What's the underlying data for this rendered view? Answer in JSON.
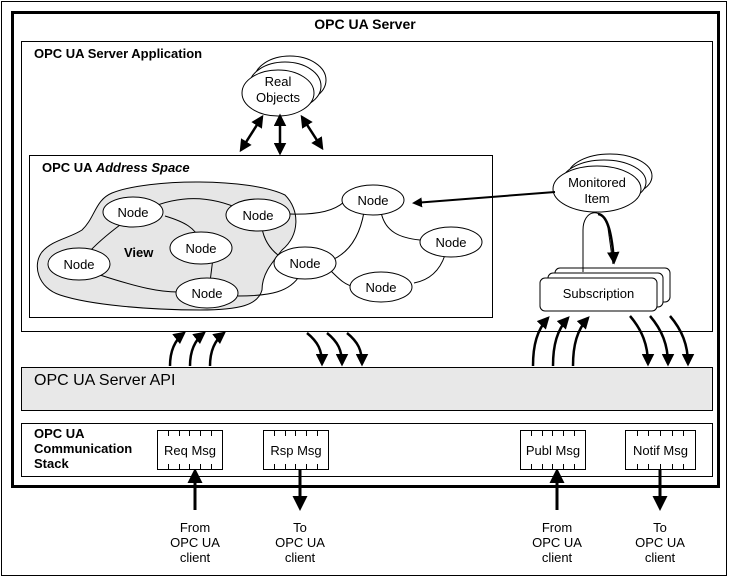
{
  "diagram": {
    "server_title": "OPC UA Server",
    "application_title": "OPC UA Server Application",
    "address_space_title_prefix": "OPC UA ",
    "address_space_title_italic": "Address Space",
    "view_label": "View",
    "real_objects_line1": "Real",
    "real_objects_line2": "Objects",
    "monitored_item_line1": "Monitored",
    "monitored_item_line2": "Item",
    "subscription_label": "Subscription",
    "node_label": "Node",
    "api_title": "OPC UA Server API",
    "stack_title_line1": "OPC UA",
    "stack_title_line2": "Communication",
    "stack_title_line3": "Stack",
    "messages": [
      {
        "label": "Req Msg",
        "direction": "in"
      },
      {
        "label": "Rsp Msg",
        "direction": "out"
      },
      {
        "label": "Publ Msg",
        "direction": "in"
      },
      {
        "label": "Notif Msg",
        "direction": "out"
      }
    ],
    "clients": [
      {
        "line1": "From",
        "line2": "OPC UA",
        "line3": "client"
      },
      {
        "line1": "To",
        "line2": "OPC UA",
        "line3": "client"
      },
      {
        "line1": "From",
        "line2": "OPC UA",
        "line3": "client"
      },
      {
        "line1": "To",
        "line2": "OPC UA",
        "line3": "client"
      }
    ],
    "colors": {
      "view_fill": "#e6e6e6",
      "api_fill": "#e8e8e8",
      "line": "#000000"
    }
  }
}
